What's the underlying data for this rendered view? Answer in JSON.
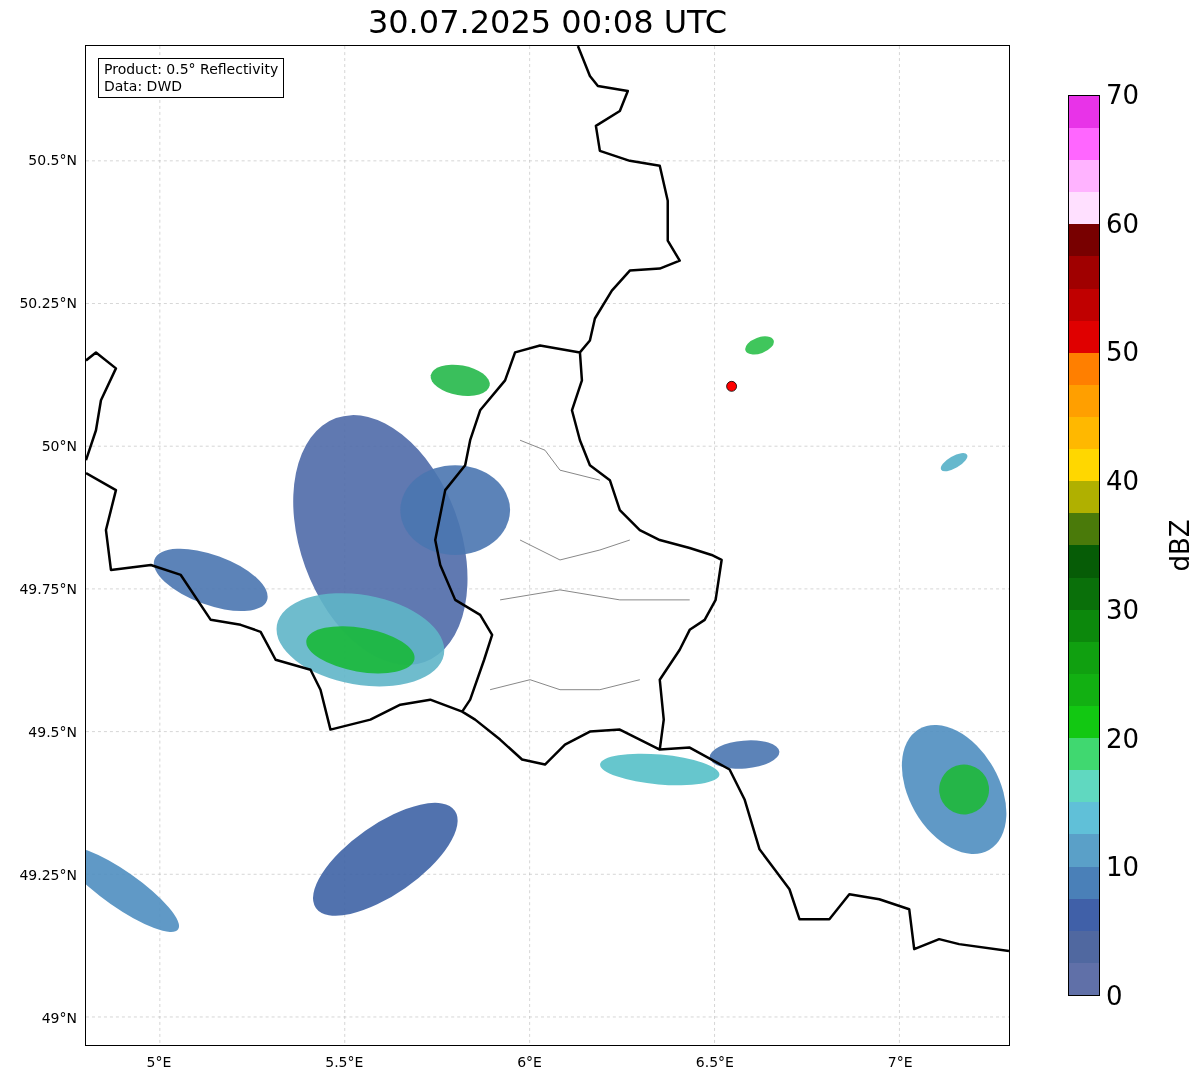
{
  "title": "30.07.2025 00:08 UTC",
  "info_box": {
    "lines": [
      "Product: 0.5° Reflectivity",
      "Data: DWD"
    ]
  },
  "map": {
    "y_ticks": [
      "50.5°N",
      "50.25°N",
      "50°N",
      "49.75°N",
      "49.5°N",
      "49.25°N",
      "49°N"
    ],
    "x_ticks": [
      "5°E",
      "5.5°E",
      "6°E",
      "6.5°E",
      "7°E"
    ]
  },
  "colorbar": {
    "label": "dBZ",
    "ticks": [
      "70",
      "60",
      "50",
      "40",
      "30",
      "20",
      "10",
      "0"
    ],
    "segments": [
      {
        "color": "#6070a8"
      },
      {
        "color": "#5068a0"
      },
      {
        "color": "#4060a8"
      },
      {
        "color": "#4a80b8"
      },
      {
        "color": "#5aa0c8"
      },
      {
        "color": "#60c0d8"
      },
      {
        "color": "#60d8c0"
      },
      {
        "color": "#40d870"
      },
      {
        "color": "#12c812"
      },
      {
        "color": "#12b012"
      },
      {
        "color": "#10a010"
      },
      {
        "color": "#0c880c"
      },
      {
        "color": "#0a700a"
      },
      {
        "color": "#065c06"
      },
      {
        "color": "#4a7a0a"
      },
      {
        "color": "#b0b000"
      },
      {
        "color": "#ffd700"
      },
      {
        "color": "#ffb800"
      },
      {
        "color": "#ff9f00"
      },
      {
        "color": "#ff7f00"
      },
      {
        "color": "#e00000"
      },
      {
        "color": "#c00000"
      },
      {
        "color": "#a00000"
      },
      {
        "color": "#780000"
      },
      {
        "color": "#ffe0ff"
      },
      {
        "color": "#ffb3ff"
      },
      {
        "color": "#ff66ff"
      },
      {
        "color": "#e833e8"
      }
    ]
  }
}
